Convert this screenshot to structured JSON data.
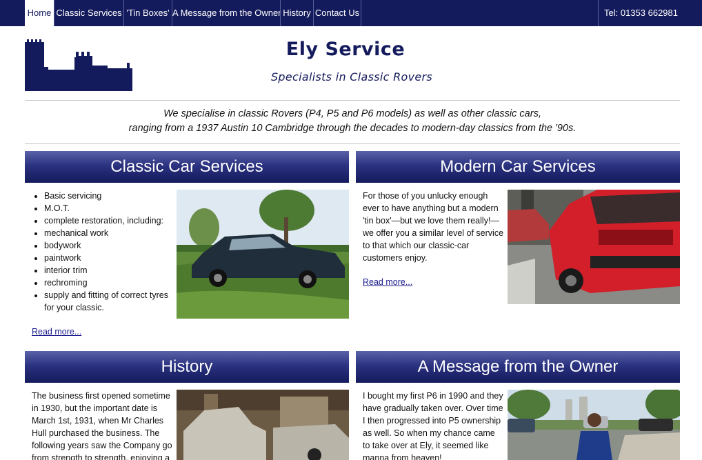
{
  "nav": {
    "items": [
      "Home",
      "Classic Services",
      "'Tin Boxes'",
      "A Message from the Owner",
      "History",
      "Contact Us"
    ],
    "telephone": "Tel: 01353 662981"
  },
  "header": {
    "title": "Ely Service",
    "subtitle": "Specialists in Classic Rovers"
  },
  "intro": {
    "line1": "We specialise in classic Rovers (P4, P5 and P6 models) as well as other classic cars,",
    "line2": "ranging from a 1937 Austin 10 Cambridge through the decades to modern-day classics from the '90s."
  },
  "classic": {
    "heading": "Classic Car Services",
    "items": [
      "Basic servicing",
      "M.O.T.",
      "complete restoration, including:",
      "mechanical work",
      "bodywork",
      "paintwork",
      "interior trim",
      "rechroming",
      "supply and fitting of correct tyres for your classic."
    ],
    "read_more": "Read more..."
  },
  "modern": {
    "heading": "Modern Car Services",
    "text": "For those of you unlucky enough ever to have anything but a modern 'tin box'—but we love them really!— we offer you a similar level of service to that which our classic-car customers enjoy.",
    "read_more": "Read more..."
  },
  "history": {
    "heading": "History",
    "text": "The business first opened sometime in 1930, but the important date is March 1st, 1931, when Mr Charles Hull purchased the business. The following years saw the Company go from strength to strength, enjoying a"
  },
  "owner": {
    "heading": "A Message from the Owner",
    "text": "I bought my first P6 in 1990 and they have gradually taken over. Over time I then progressed into P5 ownership as well. So when my chance came to take over at Ely, it seemed like manna from heaven!"
  },
  "colors": {
    "navy": "#141b5c",
    "link": "#1a1a8c"
  }
}
